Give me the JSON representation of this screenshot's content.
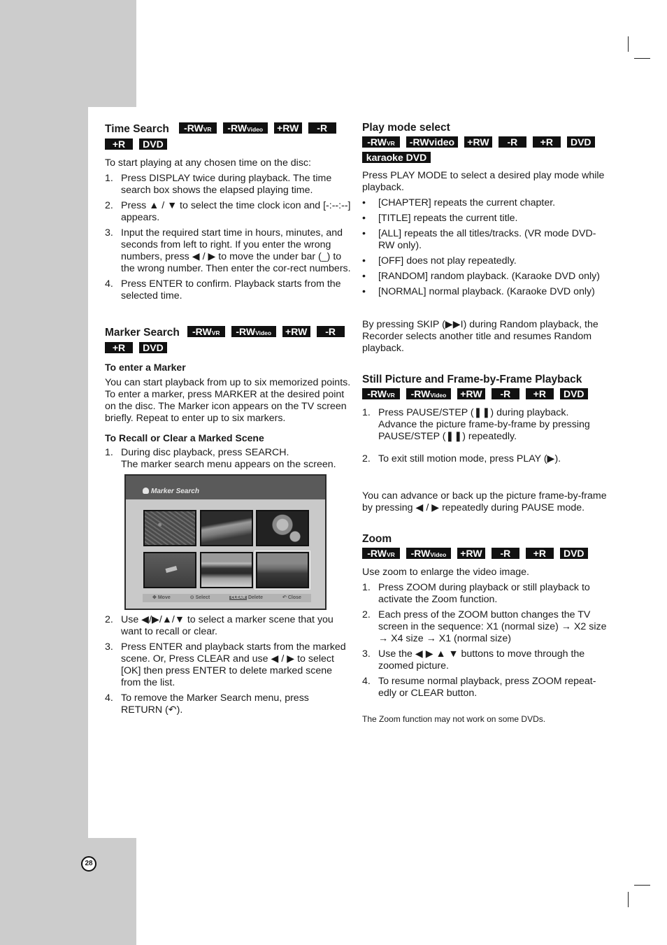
{
  "page_number": "28",
  "badges": {
    "rw": "-RW",
    "vr": "VR",
    "video_small": "Video",
    "rwvideo_lower": "-RWvideo",
    "plus_rw": "+RW",
    "minus_r": "-R",
    "plus_r": "+R",
    "dvd": "DVD",
    "karaoke": "karaoke DVD"
  },
  "time_search": {
    "title": "Time Search",
    "intro": "To start playing at any chosen time on the disc:",
    "steps": [
      {
        "num": "1.",
        "text": "Press DISPLAY twice during playback. The time search box shows the elapsed playing time."
      },
      {
        "num": "2.",
        "text": "Press ▲ / ▼ to select the time clock icon and [-:--:--] appears."
      },
      {
        "num": "3.",
        "text": "Input the required start time in hours, minutes, and seconds from left to right. If you enter the wrong numbers, press ◀ / ▶ to move the under bar (_) to the wrong number. Then enter the cor-rect numbers."
      },
      {
        "num": "4.",
        "text": "Press ENTER to confirm. Playback starts from the selected time."
      }
    ]
  },
  "marker_search": {
    "title": "Marker Search",
    "enter_heading": "To enter a Marker",
    "enter_text": "You can start playback from up to six memorized points. To enter a marker, press MARKER at the desired point on the disc. The Marker icon appears on the TV screen briefly. Repeat to enter up to six markers.",
    "recall_heading": "To Recall or Clear a Marked Scene",
    "step1": {
      "num": "1.",
      "text": "During disc playback, press SEARCH.",
      "text2": "The marker search menu appears on the screen."
    },
    "osd": {
      "title": "Marker Search",
      "footer": [
        {
          "icon": "✥",
          "label": "Move"
        },
        {
          "icon": "⊙",
          "label": "Select"
        },
        {
          "icon": "CLEAR",
          "label": "Delete"
        },
        {
          "icon": "↶",
          "label": "Close"
        }
      ]
    },
    "steps": [
      {
        "num": "2.",
        "text": "Use ◀/▶/▲/▼ to select a marker scene that you want to recall or clear."
      },
      {
        "num": "3.",
        "text": "Press ENTER and playback starts from the marked scene. Or, Press CLEAR and use ◀ / ▶ to select [OK] then press ENTER to delete marked scene from the list."
      },
      {
        "num": "4.",
        "text": "To remove the Marker Search menu, press RETURN (↶)."
      }
    ]
  },
  "play_mode": {
    "title": "Play mode select",
    "intro": "Press PLAY MODE to select a desired play mode while playback.",
    "bullets": [
      "[CHAPTER] repeats the current chapter.",
      "[TITLE] repeats the current title.",
      "[ALL] repeats the all titles/tracks. (VR mode DVD-RW only).",
      "[OFF] does not play repeatedly.",
      "[RANDOM] random playback. (Karaoke DVD only)",
      "[NORMAL] normal playback. (Karaoke DVD only)"
    ],
    "bullet_char": "•",
    "note": "By pressing SKIP (▶▶I) during Random playback, the Recorder selects another title and resumes Random playback."
  },
  "still_picture": {
    "title": "Still Picture and Frame-by-Frame Playback",
    "steps": [
      {
        "num": "1.",
        "text": "Press PAUSE/STEP (❚❚) during playback. Advance the picture frame-by-frame by pressing PAUSE/STEP (❚❚) repeatedly."
      },
      {
        "num": "2.",
        "text": "To exit still motion mode, press PLAY (▶)."
      }
    ],
    "note": "You can advance or back up the picture frame-by-frame by pressing ◀ / ▶ repeatedly during PAUSE mode."
  },
  "zoom": {
    "title": "Zoom",
    "intro": "Use zoom to enlarge the video image.",
    "steps": [
      {
        "num": "1.",
        "text": "Press ZOOM during playback or still playback to activate the Zoom function."
      },
      {
        "num": "2.",
        "text": "Each press of the ZOOM button changes the TV screen in the sequence: X1 (normal size) → X2 size → X4 size → X1 (normal size)"
      },
      {
        "num": "3.",
        "text": "Use the ◀ ▶ ▲ ▼ buttons to move through the zoomed picture."
      },
      {
        "num": "4.",
        "text": "To resume normal playback, press ZOOM repeat-edly or CLEAR button."
      }
    ],
    "note": "The Zoom function may not work on some DVDs."
  }
}
